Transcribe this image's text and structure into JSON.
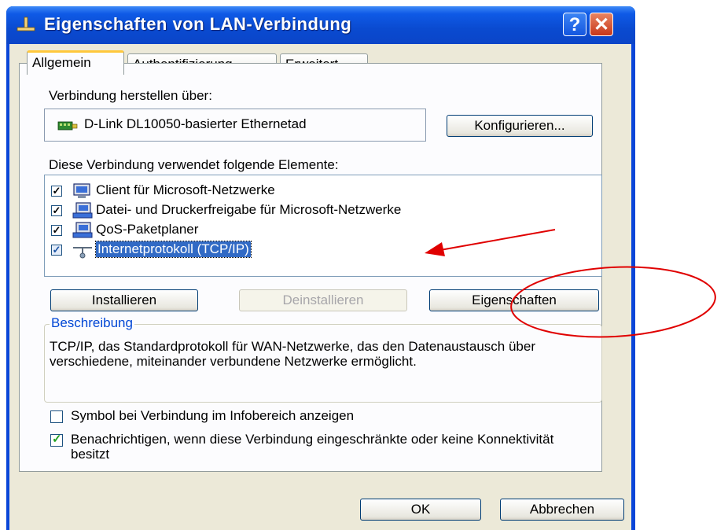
{
  "window": {
    "title": "Eigenschaften von LAN-Verbindung",
    "help_label": "?",
    "close_label": "✕"
  },
  "tabs": [
    {
      "label": "Allgemein"
    },
    {
      "label": "Authentifizierung"
    },
    {
      "label": "Erweitert"
    }
  ],
  "connect_via": {
    "label": "Verbindung herstellen über:",
    "adapter": "D-Link DL10050-basierter Ethernetad",
    "configure_button": "Konfigurieren..."
  },
  "components": {
    "label": "Diese Verbindung verwendet folgende Elemente:",
    "items": [
      {
        "label": "Client für Microsoft-Netzwerke",
        "checked": true,
        "icon": "network-client-icon"
      },
      {
        "label": "Datei- und Druckerfreigabe für Microsoft-Netzwerke",
        "checked": true,
        "icon": "network-service-icon"
      },
      {
        "label": "QoS-Paketplaner",
        "checked": true,
        "icon": "network-service-icon"
      },
      {
        "label": "Internetprotokoll (TCP/IP)",
        "checked": true,
        "selected": true,
        "icon": "protocol-icon"
      }
    ]
  },
  "buttons": {
    "install": "Installieren",
    "uninstall": "Deinstallieren",
    "properties": "Eigenschaften",
    "ok": "OK",
    "cancel": "Abbrechen"
  },
  "description": {
    "title": "Beschreibung",
    "text": "TCP/IP, das Standardprotokoll für WAN-Netzwerke, das den Datenaustausch über verschiedene, miteinander verbundene Netzwerke ermöglicht."
  },
  "options": {
    "show_icon": {
      "label": "Symbol bei Verbindung im Infobereich anzeigen",
      "checked": false
    },
    "notify": {
      "label": "Benachrichtigen, wenn diese Verbindung eingeschränkte oder keine Konnektivität besitzt",
      "checked": true
    }
  },
  "colors": {
    "title_bar": "#0a4ad0",
    "selection": "#316ac5",
    "annotation": "#e00000",
    "group_title": "#0046d5"
  }
}
